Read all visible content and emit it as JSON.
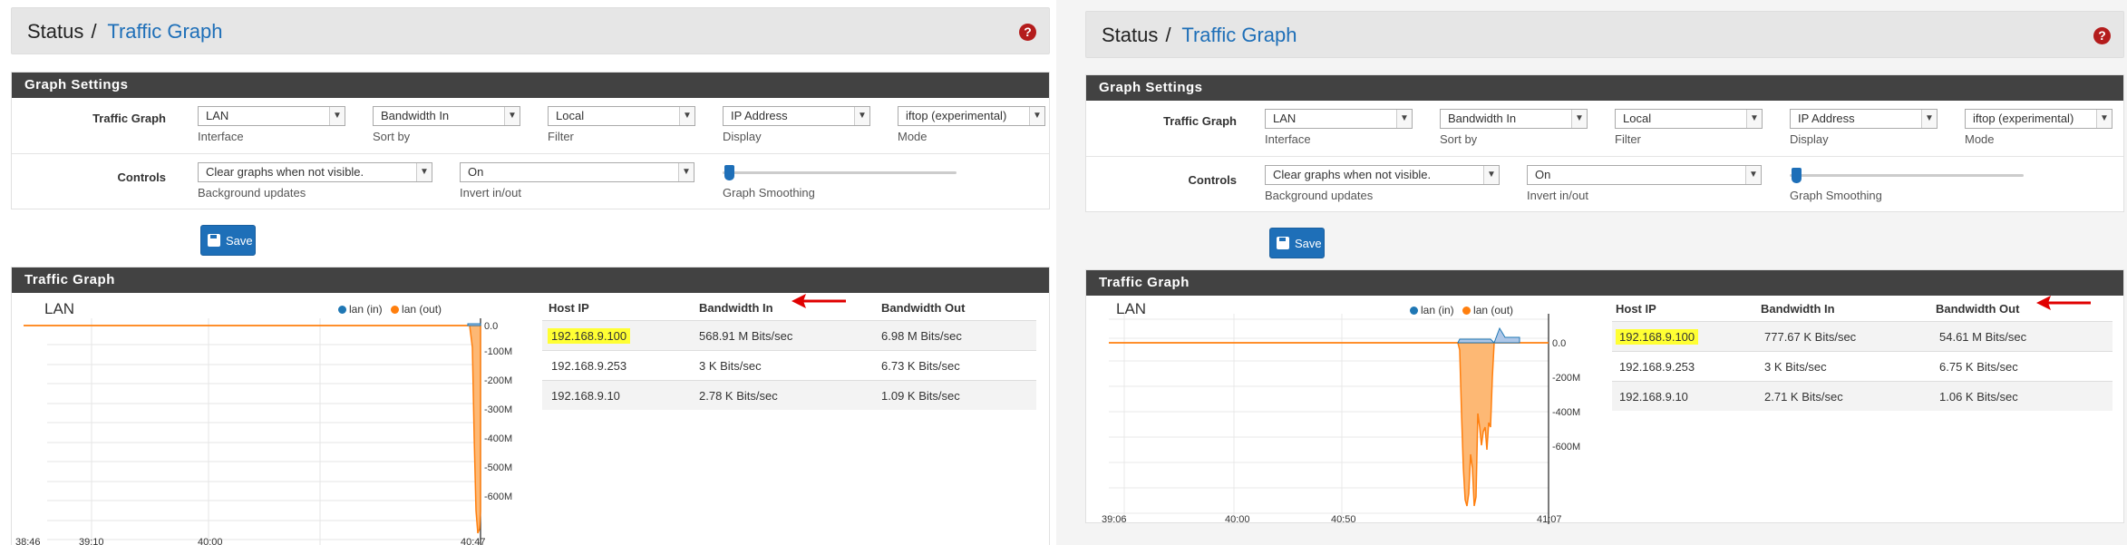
{
  "screens": [
    {
      "breadcrumb": {
        "status": "Status",
        "sep": "/",
        "page": "Traffic Graph"
      },
      "help_icon": "?",
      "settings": {
        "title": "Graph Settings",
        "traffic_graph_label": "Traffic Graph",
        "interface": {
          "value": "LAN",
          "hint": "Interface"
        },
        "sort": {
          "value": "Bandwidth In",
          "hint": "Sort by"
        },
        "filter": {
          "value": "Local",
          "hint": "Filter"
        },
        "display": {
          "value": "IP Address",
          "hint": "Display"
        },
        "mode": {
          "value": "iftop (experimental)",
          "hint": "Mode"
        },
        "controls_label": "Controls",
        "background": {
          "value": "Clear graphs when not visible.",
          "hint": "Background updates"
        },
        "invert": {
          "value": "On",
          "hint": "Invert in/out"
        },
        "smoothing": {
          "hint": "Graph Smoothing",
          "value": 0
        }
      },
      "save_label": "Save",
      "graph": {
        "panel_title": "Traffic Graph",
        "chart_title": "LAN",
        "legend_in": "lan (in)",
        "legend_out": "lan (out)",
        "y_ticks": [
          "0.0",
          "-100M",
          "-200M",
          "-300M",
          "-400M",
          "-500M",
          "-600M"
        ],
        "x_ticks": [
          "38:46",
          "39:10",
          "40:00",
          "40:47"
        ]
      },
      "table": {
        "headers": [
          "Host IP",
          "Bandwidth In",
          "Bandwidth Out"
        ],
        "rows": [
          [
            "192.168.9.100",
            "568.91 M Bits/sec",
            "6.98 M Bits/sec"
          ],
          [
            "192.168.9.253",
            "3 K Bits/sec",
            "6.73 K Bits/sec"
          ],
          [
            "192.168.9.10",
            "2.78 K Bits/sec",
            "1.09 K Bits/sec"
          ]
        ]
      },
      "arrow_target": "Bandwidth In"
    },
    {
      "breadcrumb": {
        "status": "Status",
        "sep": "/",
        "page": "Traffic Graph"
      },
      "help_icon": "?",
      "settings": {
        "title": "Graph Settings",
        "traffic_graph_label": "Traffic Graph",
        "interface": {
          "value": "LAN",
          "hint": "Interface"
        },
        "sort": {
          "value": "Bandwidth In",
          "hint": "Sort by"
        },
        "filter": {
          "value": "Local",
          "hint": "Filter"
        },
        "display": {
          "value": "IP Address",
          "hint": "Display"
        },
        "mode": {
          "value": "iftop (experimental)",
          "hint": "Mode"
        },
        "controls_label": "Controls",
        "background": {
          "value": "Clear graphs when not visible.",
          "hint": "Background updates"
        },
        "invert": {
          "value": "On",
          "hint": "Invert in/out"
        },
        "smoothing": {
          "hint": "Graph Smoothing",
          "value": 0
        }
      },
      "save_label": "Save",
      "graph": {
        "panel_title": "Traffic Graph",
        "chart_title": "LAN",
        "legend_in": "lan (in)",
        "legend_out": "lan (out)",
        "y_ticks": [
          "0.0",
          "-200M",
          "-400M",
          "-600M"
        ],
        "x_ticks": [
          "39:06",
          "40:00",
          "40:50",
          "41:07"
        ]
      },
      "table": {
        "headers": [
          "Host IP",
          "Bandwidth In",
          "Bandwidth Out"
        ],
        "rows": [
          [
            "192.168.9.100",
            "777.67 K Bits/sec",
            "54.61 M Bits/sec"
          ],
          [
            "192.168.9.253",
            "3 K Bits/sec",
            "6.75 K Bits/sec"
          ],
          [
            "192.168.9.10",
            "2.71 K Bits/sec",
            "1.06 K Bits/sec"
          ]
        ]
      },
      "arrow_target": "Bandwidth Out"
    }
  ],
  "colors": {
    "accent": "#1e6fb8",
    "in_series": "#1f77b4",
    "out_series": "#ff7f0e",
    "highlight": "#ffff33",
    "arrow": "#e00000"
  }
}
